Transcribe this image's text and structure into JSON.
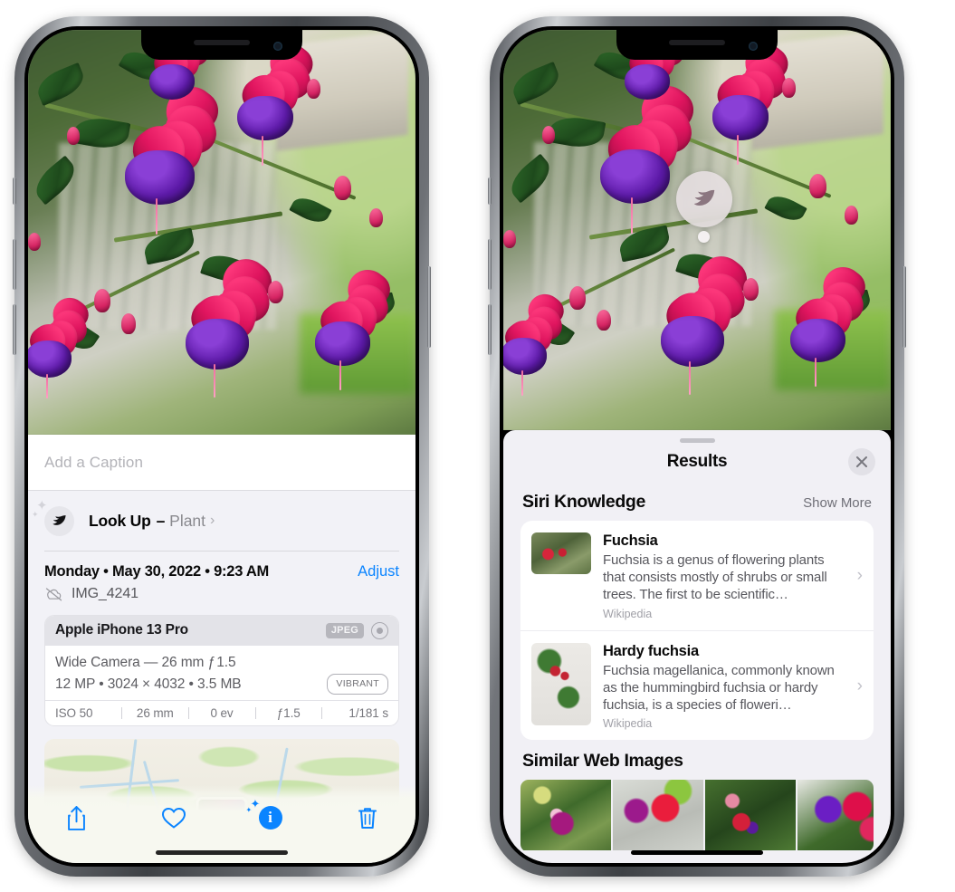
{
  "left_phone": {
    "photo": {
      "alt": "fuchsia-plant-photo"
    },
    "caption": {
      "placeholder": "Add a Caption",
      "value": ""
    },
    "look_up": {
      "icon": "leaf-icon",
      "label": "Look Up",
      "dash": "–",
      "subject": "Plant",
      "chevron": "›"
    },
    "meta": {
      "date": "Monday • May 30, 2022 • 9:23 AM",
      "adjust_label": "Adjust",
      "cloud_icon": "icloud-slash-icon",
      "filename": "IMG_4241"
    },
    "exif": {
      "device": "Apple iPhone 13 Pro",
      "format_badge": "JPEG",
      "aperture_icon": "aperture-icon",
      "lens_line": "Wide Camera — 26 mm ƒ 1.5",
      "size_line": "12 MP • 3024 × 4032 • 3.5 MB",
      "style_badge": "VIBRANT",
      "stats": [
        "ISO 50",
        "26 mm",
        "0 ev",
        "ƒ1.5",
        "1/181 s"
      ]
    },
    "toolbar": [
      {
        "name": "share-icon",
        "label": "Share"
      },
      {
        "name": "heart-icon",
        "label": "Favorite"
      },
      {
        "name": "info-icon",
        "label": "Info",
        "glyph": "i",
        "active": true
      },
      {
        "name": "trash-icon",
        "label": "Delete"
      }
    ],
    "accent_color": "#0a84ff"
  },
  "right_phone": {
    "photo": {
      "alt": "fuchsia-plant-photo"
    },
    "badge": {
      "icon": "leaf-icon",
      "label": "Visual Look Up"
    },
    "sheet": {
      "title": "Results",
      "close_icon": "close-icon",
      "sections": [
        {
          "title": "Siri Knowledge",
          "action": "Show More",
          "items": [
            {
              "title": "Fuchsia",
              "description": "Fuchsia is a genus of flowering plants that consists mostly of shrubs or small trees. The first to be scientific…",
              "source": "Wikipedia",
              "chevron": "›"
            },
            {
              "title": "Hardy fuchsia",
              "description": "Fuchsia magellanica, commonly known as the hummingbird fuchsia or hardy fuchsia, is a species of floweri…",
              "source": "Wikipedia",
              "chevron": "›"
            }
          ]
        },
        {
          "title": "Similar Web Images",
          "items": [
            {
              "alt": "web-image-1"
            },
            {
              "alt": "web-image-2"
            },
            {
              "alt": "web-image-3"
            },
            {
              "alt": "web-image-4"
            }
          ]
        }
      ]
    }
  }
}
